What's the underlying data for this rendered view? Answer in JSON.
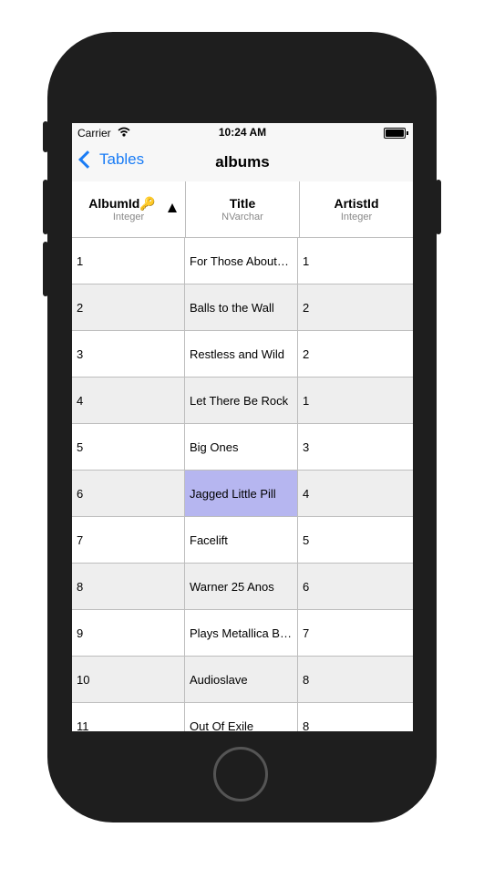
{
  "status_bar": {
    "carrier": "Carrier",
    "time": "10:24 AM"
  },
  "nav": {
    "back_label": "Tables",
    "title": "albums"
  },
  "columns": [
    {
      "name": "AlbumId",
      "type": "Integer",
      "primary_key": true,
      "sorted": "ascending"
    },
    {
      "name": "Title",
      "type": "NVarchar"
    },
    {
      "name": "ArtistId",
      "type": "Integer"
    }
  ],
  "rows": [
    [
      "1",
      "For Those About…",
      "1"
    ],
    [
      "2",
      "Balls to the Wall",
      "2"
    ],
    [
      "3",
      "Restless and Wild",
      "2"
    ],
    [
      "4",
      "Let There Be Rock",
      "1"
    ],
    [
      "5",
      "Big Ones",
      "3"
    ],
    [
      "6",
      "Jagged Little Pill",
      "4"
    ],
    [
      "7",
      "Facelift",
      "5"
    ],
    [
      "8",
      "Warner 25 Anos",
      "6"
    ],
    [
      "9",
      "Plays Metallica B…",
      "7"
    ],
    [
      "10",
      "Audioslave",
      "8"
    ],
    [
      "11",
      "Out Of Exile",
      "8"
    ]
  ],
  "selected_cell": {
    "row": 6,
    "column": "Title"
  },
  "colors": {
    "accent": "#1a7cf5",
    "selection": "#b6b6f0",
    "alt_row": "#eeeeee"
  }
}
